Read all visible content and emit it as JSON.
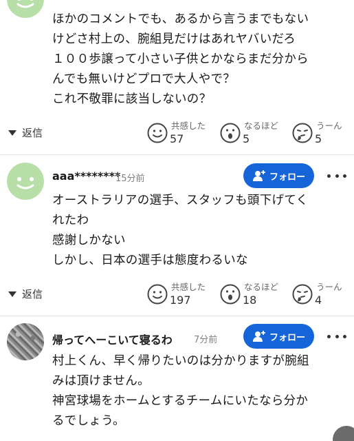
{
  "comments": [
    {
      "username": "",
      "time": "",
      "lines": [
        "ほかのコメントでも、あるから言うまでもない",
        "けどさ村上の、腕組見だけはあれヤバいだろ",
        "１００歩譲って小さい子供とかならまだ分から",
        "んでも無いけどプロで大人やで？",
        "これ不敬罪に該当しないの？"
      ],
      "reply_label": "返信",
      "reactions": [
        {
          "label": "共感した",
          "count": "57",
          "icon": "smile-face-icon"
        },
        {
          "label": "なるほど",
          "count": "5",
          "icon": "surprised-face-icon"
        },
        {
          "label": "うーん",
          "count": "5",
          "icon": "thinking-face-icon"
        }
      ]
    },
    {
      "username": "aaa********",
      "time": "15分前",
      "follow_label": "フォロー",
      "lines": [
        "オーストラリアの選手、スタッフも頭下げてく",
        "れたわ",
        "感謝しかない",
        "しかし、日本の選手は態度わるいな"
      ],
      "reply_label": "返信",
      "reactions": [
        {
          "label": "共感した",
          "count": "197",
          "icon": "smile-face-icon"
        },
        {
          "label": "なるほど",
          "count": "18",
          "icon": "surprised-face-icon"
        },
        {
          "label": "うーん",
          "count": "4",
          "icon": "thinking-face-icon"
        }
      ]
    },
    {
      "username": "帰ってへーこいて寝るわ",
      "time": "7分前",
      "follow_label": "フォロー",
      "lines": [
        "村上くん、早く帰りたいのは分かりますが腕組",
        "みは頂けません。",
        "神宮球場をホームとするチームにいたなら分か",
        "るでしょう。"
      ]
    }
  ],
  "colors": {
    "follow_button": "#1665d8",
    "avatar_green": "#b9dfa8",
    "separator": "#f2f2f2"
  }
}
